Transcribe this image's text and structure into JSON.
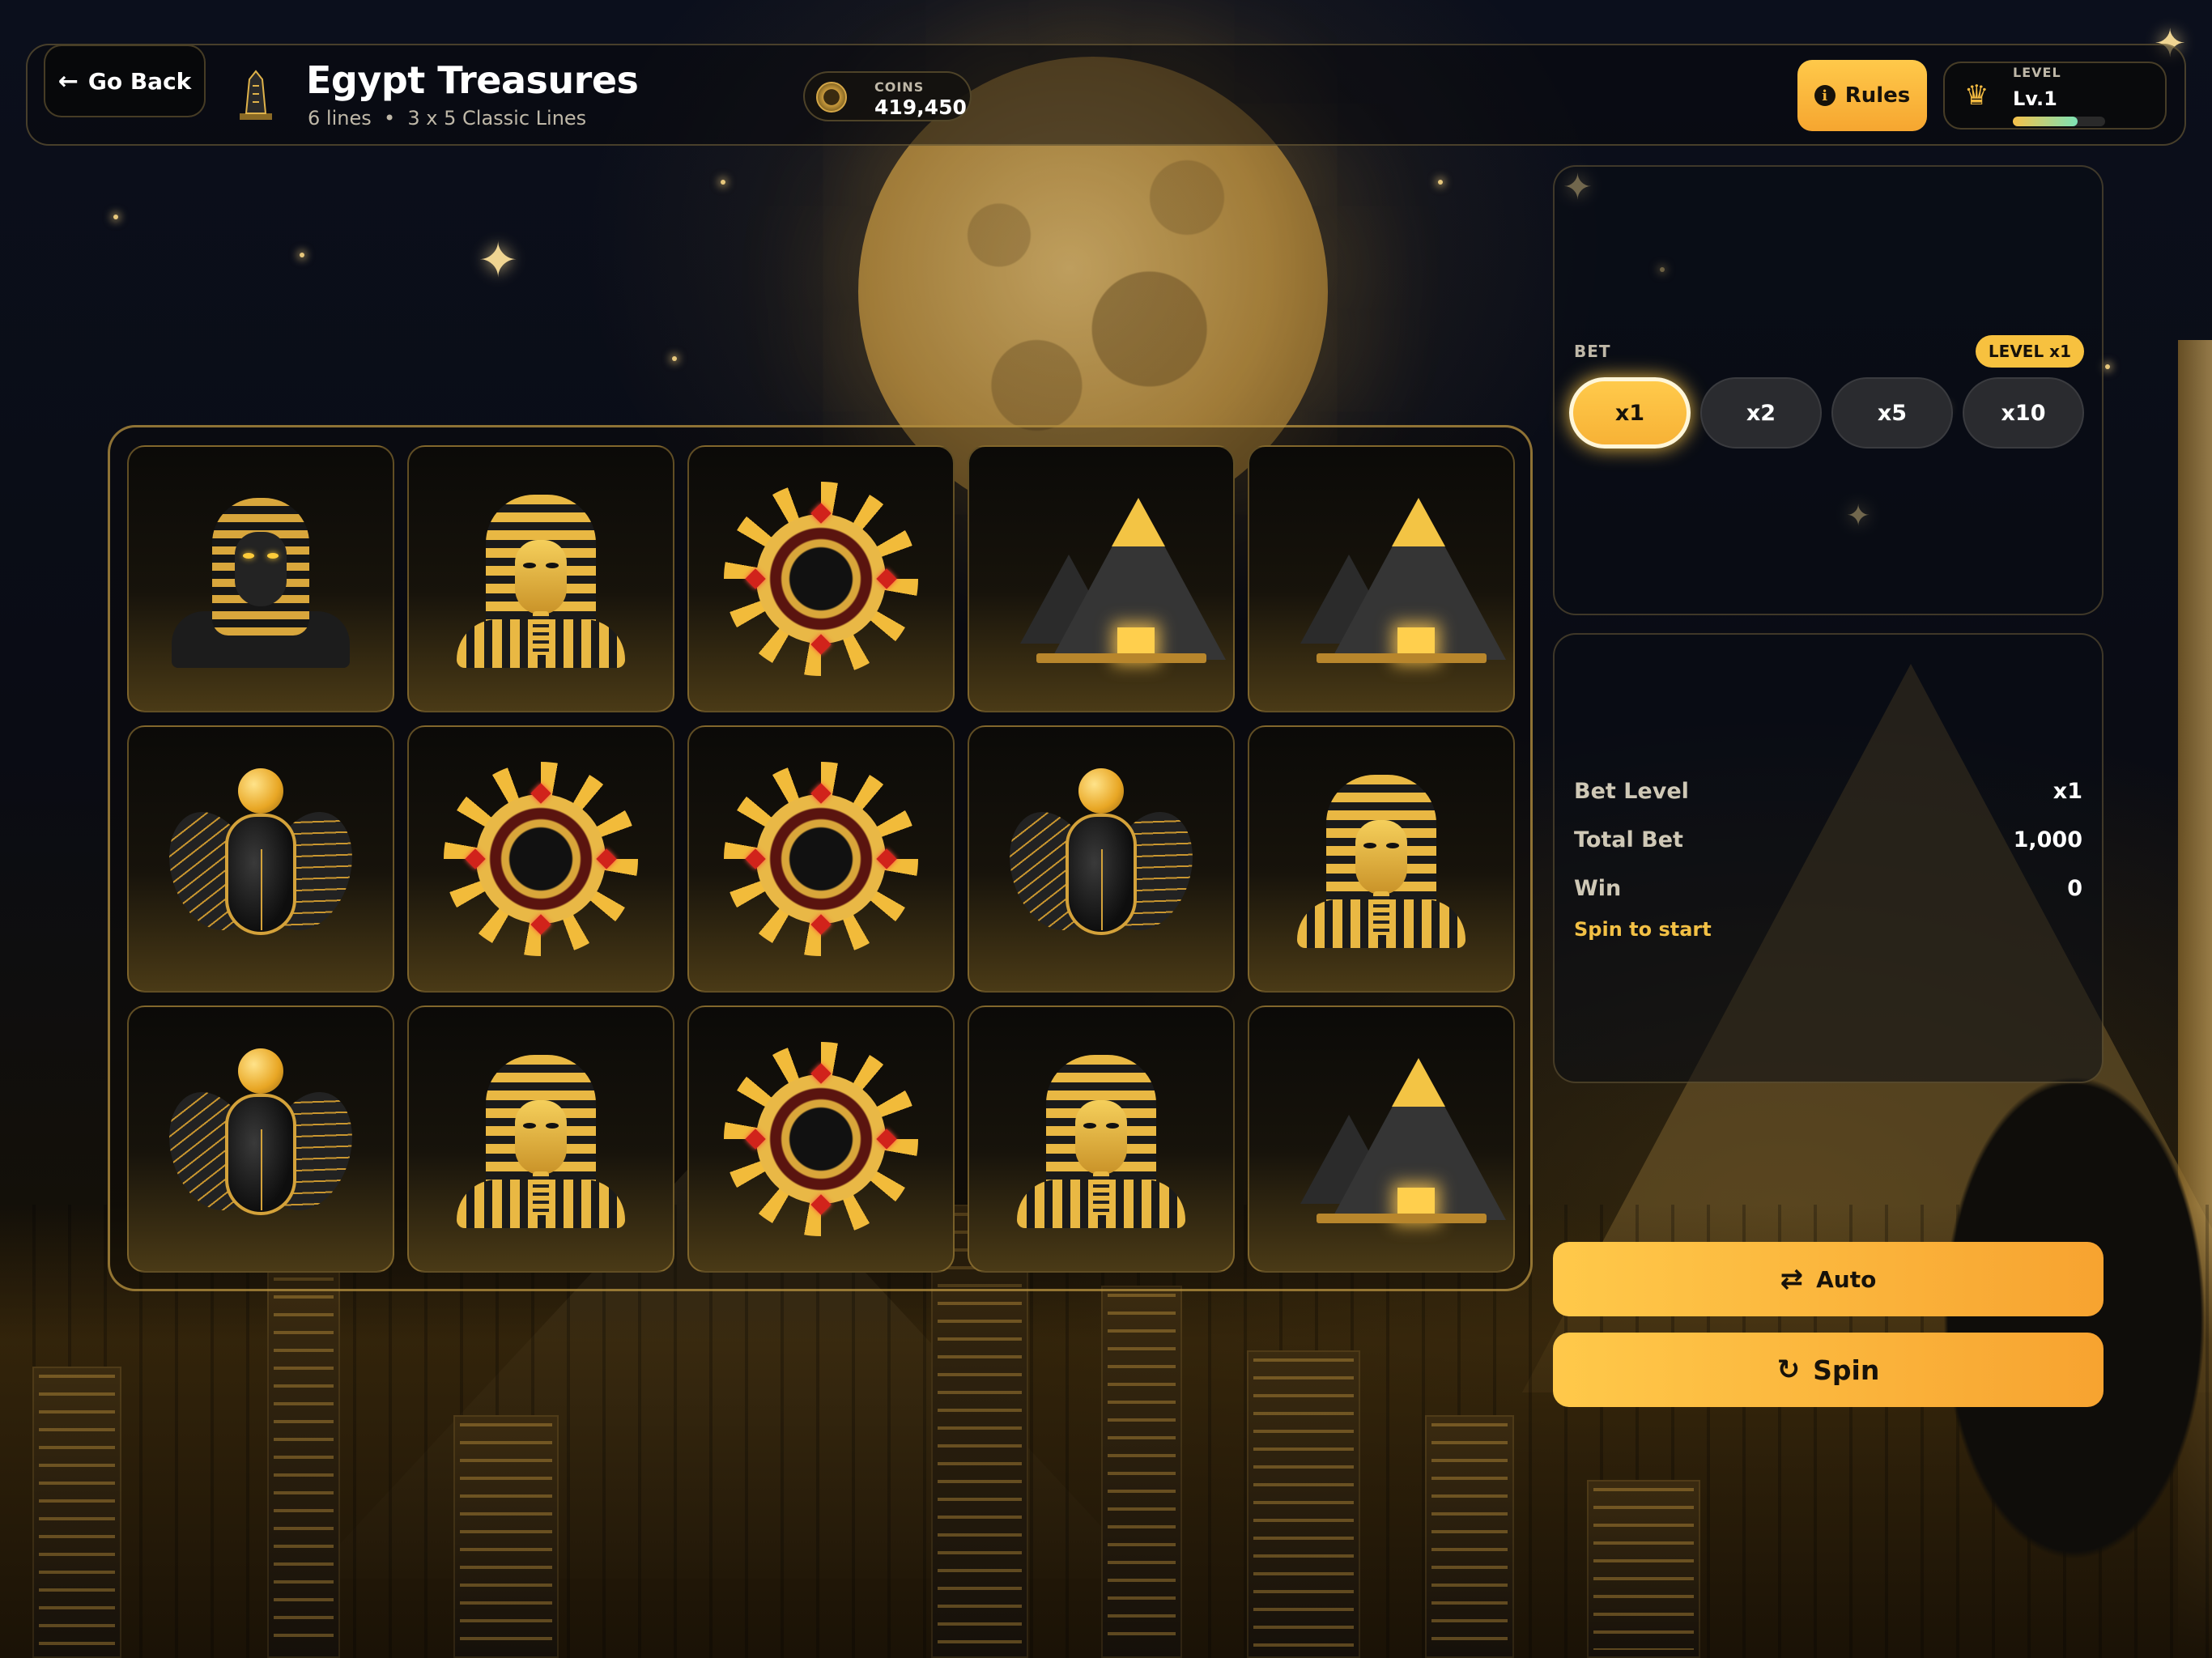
{
  "header": {
    "back_label": "Go Back",
    "title": "Egypt Treasures",
    "lines": "6 lines",
    "separator": "•",
    "layout": "3 x 5 Classic Lines",
    "coins_label": "COINS",
    "coins_value": "419,450",
    "rules_label": "Rules",
    "level_label": "LEVEL",
    "level_value": "Lv.1",
    "level_progress": 0.7
  },
  "reels": {
    "rows": [
      [
        "sphinx",
        "pharaoh",
        "sun-amulet",
        "pyramid",
        "pyramid"
      ],
      [
        "scarab",
        "sun-amulet",
        "sun-amulet",
        "scarab",
        "pharaoh"
      ],
      [
        "scarab",
        "pharaoh",
        "sun-amulet",
        "pharaoh",
        "pyramid"
      ]
    ]
  },
  "bet": {
    "label": "BET",
    "level_badge": "LEVEL x1",
    "options": [
      "x1",
      "x2",
      "x5",
      "x10"
    ],
    "selected": "x1"
  },
  "stats": {
    "bet_level_label": "Bet Level",
    "bet_level_value": "x1",
    "total_bet_label": "Total Bet",
    "total_bet_value": "1,000",
    "win_label": "Win",
    "win_value": "0",
    "hint": "Spin to start"
  },
  "actions": {
    "auto_label": "Auto",
    "spin_label": "Spin"
  },
  "colors": {
    "accent": "#f7b236",
    "gold": "#e9b843",
    "panel_border": "#be a05a"
  }
}
